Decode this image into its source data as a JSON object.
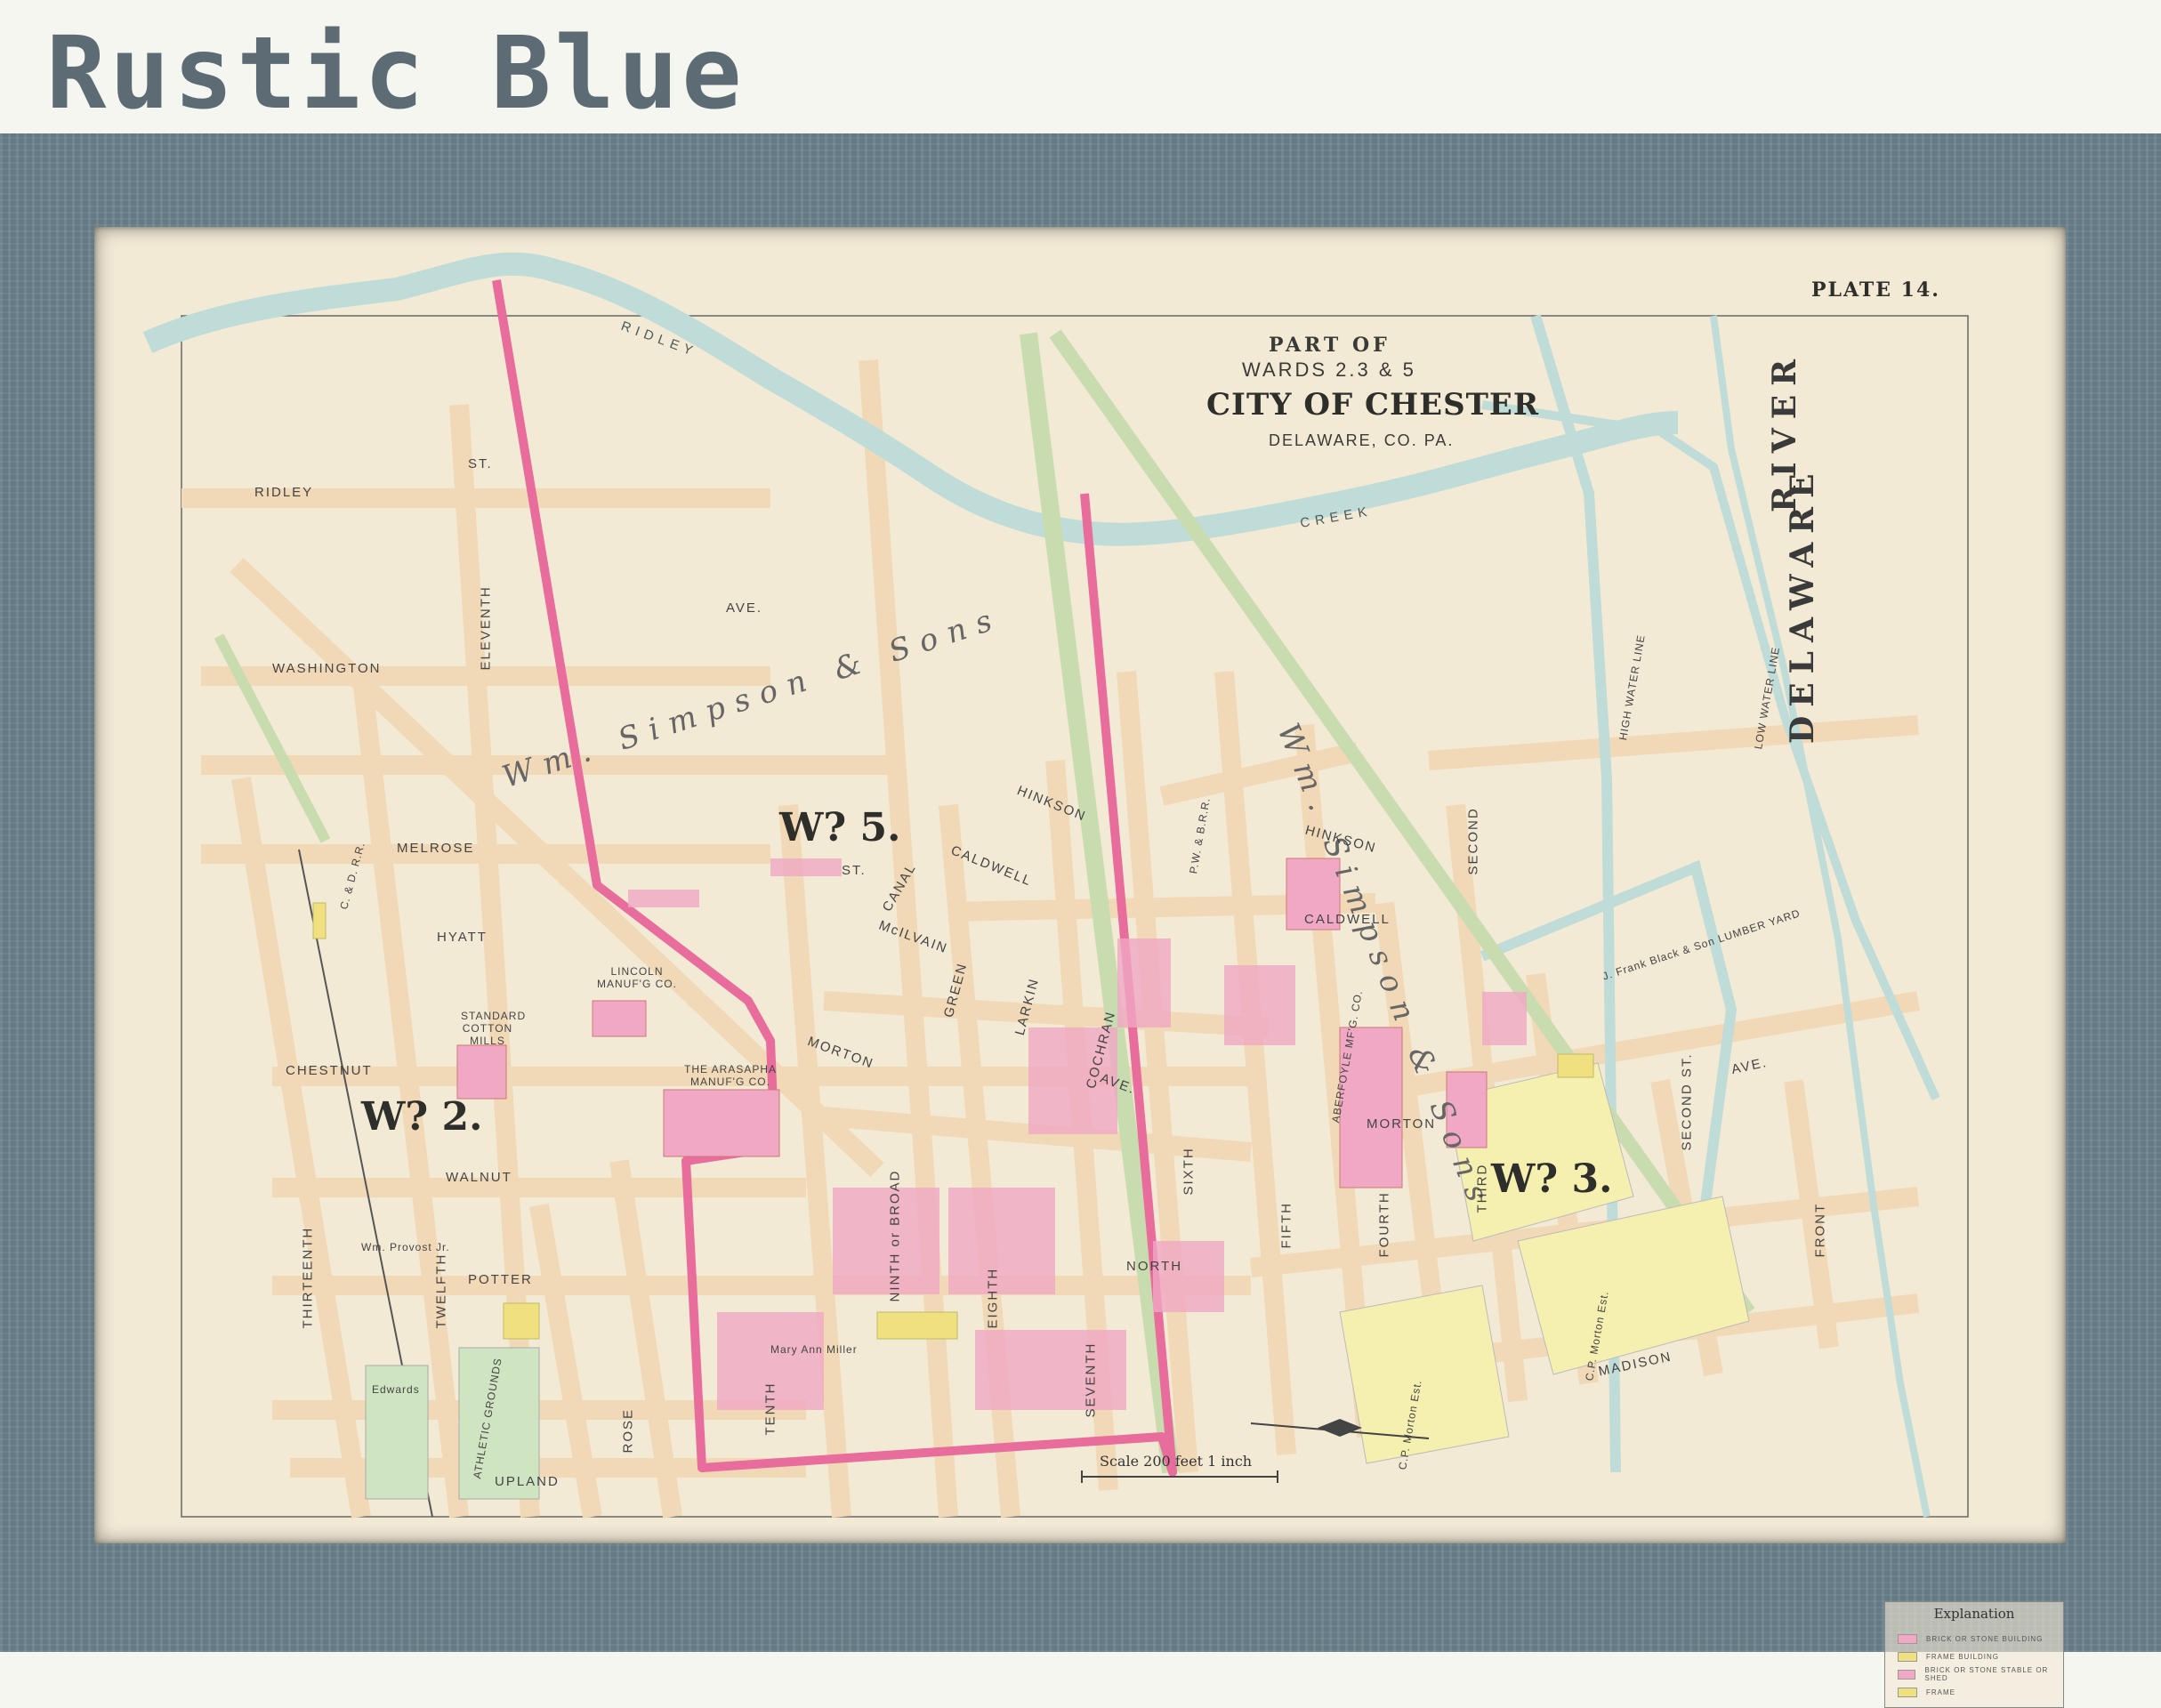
{
  "header": {
    "title": "Rustic Blue"
  },
  "colors": {
    "frame": "#6d838e",
    "paper": "#f3ead6",
    "street": "#f1d8b6",
    "ward_boundary": "#e86c9c",
    "water": "#bfdcd8",
    "railroad": "#c8dcb0",
    "brick_building": "#f0a8c4",
    "frame_building": "#f0e080",
    "estate": "#f5efb0",
    "grounds": "#cfe4c0"
  },
  "map": {
    "plate": "PLATE 14.",
    "title": {
      "part_of": "PART OF",
      "wards": "WARDS 2.3 & 5",
      "city": "CITY OF CHESTER",
      "county": "DELAWARE, CO. PA."
    },
    "water": {
      "ridley": "RIDLEY",
      "creek": "CREEK",
      "river_1": "DELAWARE",
      "river_2": "RIVER",
      "high_water": "HIGH WATER LINE",
      "low_water": "LOW WATER LINE"
    },
    "wards": {
      "ward5": "W? 5.",
      "ward2": "W? 2.",
      "ward3": "W? 3."
    },
    "estates": {
      "simpson_west": "Wm. Simpson & Sons",
      "simpson_east": "Wm. Simpson & Sons"
    },
    "streets": {
      "ridley_st": "RIDLEY",
      "ridley_st2": "ST.",
      "washington": "WASHINGTON",
      "ave_top": "AVE.",
      "melrose": "MELROSE",
      "hyatt": "HYATT",
      "chestnut": "CHESTNUT",
      "walnut": "WALNUT",
      "potter": "POTTER",
      "upland": "UPLAND",
      "thirteenth": "THIRTEENTH",
      "twelfth": "TWELFTH",
      "eleventh": "ELEVENTH",
      "tenth": "TENTH",
      "ninth": "NINTH or BROAD",
      "eighth": "EIGHTH",
      "seventh": "SEVENTH",
      "sixth": "SIXTH",
      "fifth": "FIFTH",
      "fourth": "FOURTH",
      "third": "THIRD",
      "second": "SECOND",
      "second_st": "SECOND ST.",
      "front": "FRONT",
      "morton": "MORTON",
      "morton_east": "MORTON",
      "caldwell": "CALDWELL",
      "caldwell_east": "CALDWELL",
      "hinkson": "HINKSON",
      "hinkson_east": "HINKSON",
      "mcilvain": "McILVAIN",
      "canal": "CANAL",
      "green": "GREEN",
      "larkin": "LARKIN",
      "cochran": "COCHRAN",
      "rose": "ROSE",
      "north": "NORTH",
      "madison": "MADISON",
      "ave_mid": "AVE.",
      "ave_east": "AVE.",
      "st_generic": "ST."
    },
    "places": {
      "standard_mills": "STANDARD COTTON MILLS",
      "arasapha": "THE ARASAPHA MANUF'G CO.",
      "lincoln": "LINCOLN MANUF'G CO.",
      "aberfoyle": "ABERFOYLE MF'G. CO.",
      "athletic": "ATHLETIC GROUNDS",
      "lumber": "J. Frank Black & Son LUMBER YARD",
      "cp_morton_est": "C.P. Morton Est.",
      "cp_morton_est2": "C.P. Morton Est.",
      "edwards": "Edwards",
      "provost": "Wm. Provost Jr.",
      "mary_miller": "Mary Ann Miller"
    },
    "railroads": {
      "pwbrr": "P.W. & B.R.R.",
      "cdrr": "C. & D. R.R."
    },
    "scale": {
      "label": "Scale 200 feet 1 inch"
    },
    "legend": {
      "title": "Explanation",
      "items": [
        {
          "label": "BRICK OR STONE BUILDING",
          "color": "#f0a8c4"
        },
        {
          "label": "FRAME BUILDING",
          "color": "#f0e080"
        },
        {
          "label": "BRICK OR STONE STABLE OR SHED",
          "color": "#f0a8c4"
        },
        {
          "label": "FRAME",
          "color": "#f0e080"
        }
      ]
    }
  }
}
